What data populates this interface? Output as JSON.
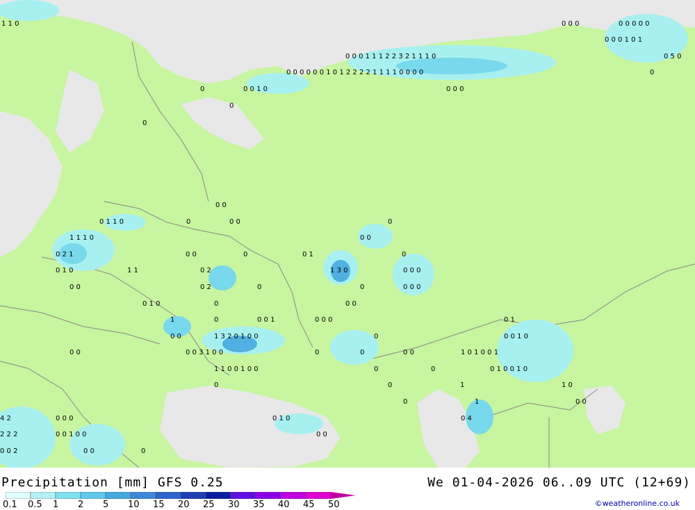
{
  "title": "Precipitation [mm]  GFS 0.25",
  "datetime": "We 01-04-2026 06..09 UTC (12+69)",
  "credit": "©weatheronline.co.uk",
  "colors": {
    "land": "#c8f5a0",
    "sea": "#e8e8e8",
    "border": "#888888",
    "precip_light": "#a8f0f0",
    "precip_mid": "#78d8ec",
    "precip_heavy": "#50b0e0"
  },
  "legend": {
    "labels": [
      "0.1",
      "0.5",
      "1",
      "2",
      "5",
      "10",
      "15",
      "20",
      "25",
      "30",
      "35",
      "40",
      "45",
      "50"
    ],
    "colors": [
      "#e0ffff",
      "#b4f0f4",
      "#80e0f0",
      "#60c8ec",
      "#48a8e0",
      "#3c88d8",
      "#2c64cc",
      "#1c40b4",
      "#0c1ca0",
      "#6010e0",
      "#8c00e8",
      "#c000e0",
      "#e000d0",
      "#c000a0"
    ]
  },
  "values_row": [
    "0",
    "1",
    "1",
    "0",
    "0",
    "0",
    "0",
    "1",
    "1",
    "1",
    "2",
    "2",
    "3",
    "2",
    "1",
    "1",
    "1",
    "0",
    "0",
    "0",
    "0",
    "0",
    "0",
    "0",
    "0",
    "1",
    "0",
    "1",
    "2",
    "2",
    "2",
    "2",
    "1",
    "1",
    "1",
    "1",
    "0",
    "0",
    "0",
    "0"
  ]
}
